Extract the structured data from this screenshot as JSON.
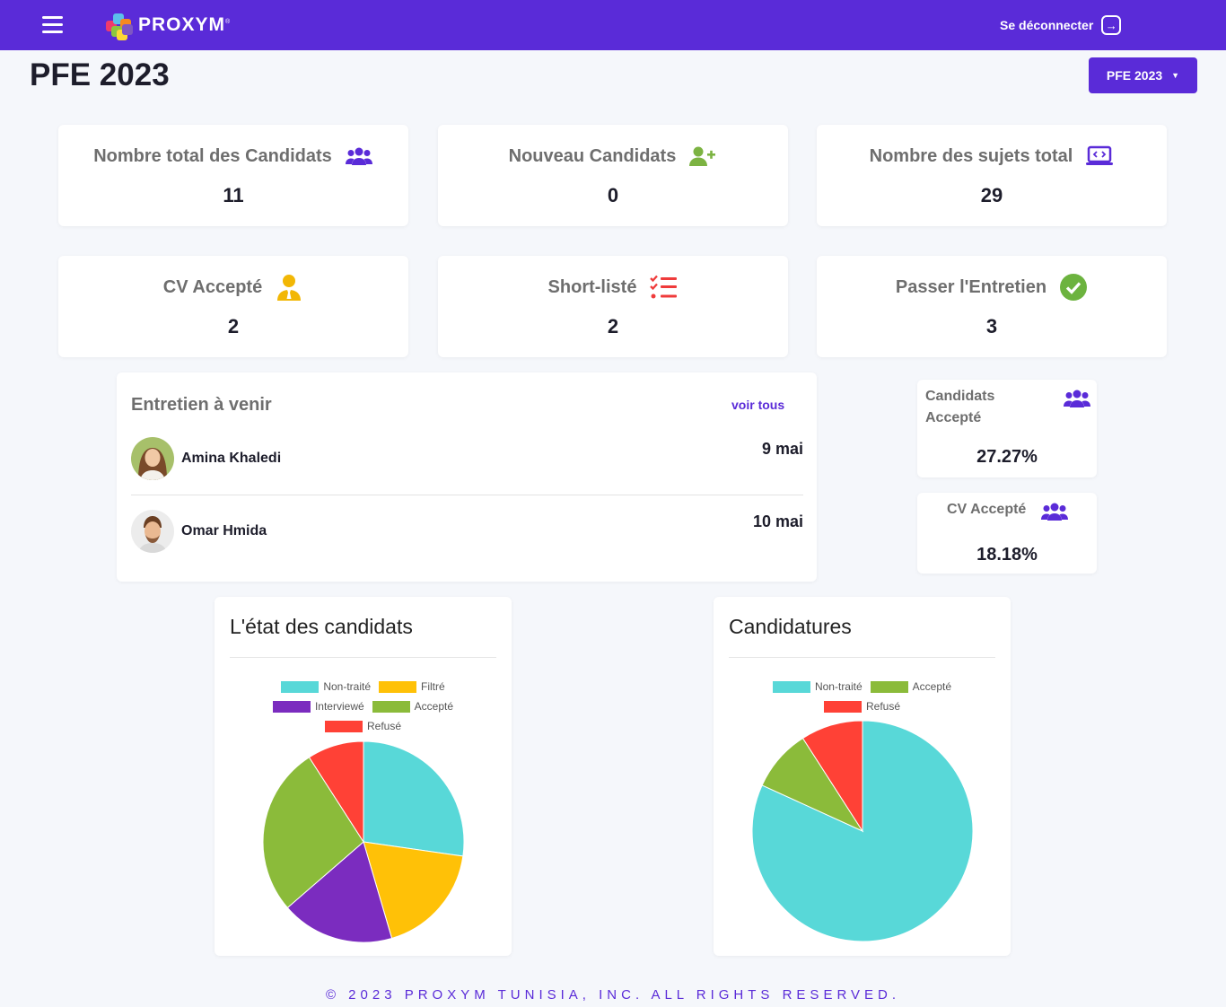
{
  "topbar": {
    "brand": "PROXYM",
    "brand_mark": "®",
    "logout_label": "Se déconnecter"
  },
  "page": {
    "title": "PFE 2023",
    "year_selected": "PFE 2023"
  },
  "stats": [
    {
      "label": "Nombre total des Candidats",
      "value": "11",
      "icon": "users-icon",
      "color": "#5a2bd8"
    },
    {
      "label": "Nouveau Candidats",
      "value": "0",
      "icon": "user-plus-icon",
      "color": "#7cb342"
    },
    {
      "label": "Nombre des sujets total",
      "value": "29",
      "icon": "laptop-code-icon",
      "color": "#5a2bd8"
    },
    {
      "label": "CV Accepté",
      "value": "2",
      "icon": "user-tie-icon",
      "color": "#f2b705"
    },
    {
      "label": "Short-listé",
      "value": "2",
      "icon": "task-list-icon",
      "color": "#ef3b3b"
    },
    {
      "label": "Passer l'Entretien",
      "value": "3",
      "icon": "check-circle-icon",
      "color": "#6cb33f"
    }
  ],
  "interviews": {
    "title": "Entretien à venir",
    "see_all": "voir tous",
    "items": [
      {
        "name": "Amina Khaledi",
        "date": "9 mai"
      },
      {
        "name": "Omar Hmida",
        "date": "10 mai"
      }
    ]
  },
  "rates": [
    {
      "label_line1": "Candidats",
      "label_line2": "Accepté",
      "value": "27.27%",
      "icon": "users-icon"
    },
    {
      "label_line1": "CV Accepté",
      "value": "18.18%",
      "icon": "users-icon"
    }
  ],
  "chart_data": [
    {
      "type": "pie",
      "title": "L'état des candidats",
      "labels": [
        "Non-traité",
        "Filtré",
        "Interviewé",
        "Accepté",
        "Refusé"
      ],
      "values": [
        3,
        2,
        2,
        3,
        1
      ],
      "colors": [
        "#58d8d8",
        "#ffc107",
        "#7b2cbf",
        "#8bbb3a",
        "#ff4136"
      ],
      "legend_position": "top"
    },
    {
      "type": "pie",
      "title": "Candidatures",
      "labels": [
        "Non-traité",
        "Accepté",
        "Refusé"
      ],
      "values": [
        9,
        1,
        1
      ],
      "colors": [
        "#58d8d8",
        "#8bbb3a",
        "#ff4136"
      ],
      "legend_position": "top"
    }
  ],
  "footer": {
    "text": "© 2023 PROXYM TUNISIA, INC. ALL RIGHTS RESERVED."
  }
}
